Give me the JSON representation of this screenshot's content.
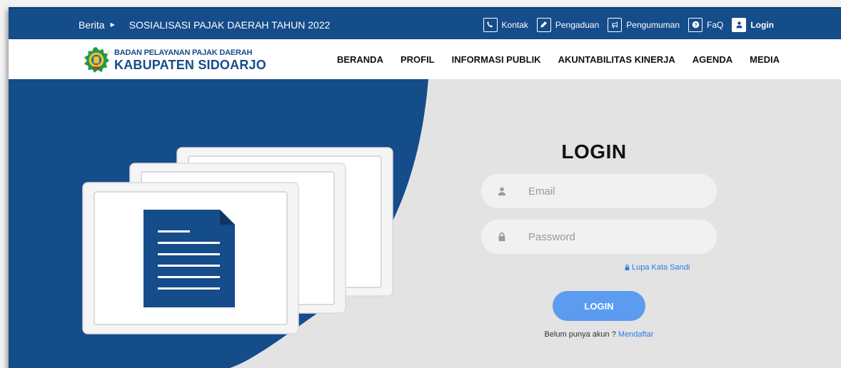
{
  "topbar": {
    "ticker_label": "Berita",
    "ticker_text": "SOSIALISASI PAJAK DAERAH TAHUN 2022",
    "links": {
      "kontak": "Kontak",
      "pengaduan": "Pengaduan",
      "pengumuman": "Pengumuman",
      "faq": "FaQ",
      "login": "Login"
    }
  },
  "brand": {
    "top": "BADAN PELAYANAN PAJAK DAERAH",
    "bottom": "KABUPATEN SIDOARJO"
  },
  "nav": {
    "beranda": "BERANDA",
    "profil": "PROFIL",
    "informasi_publik": "INFORMASI PUBLIK",
    "akuntabilitas_kinerja": "AKUNTABILITAS KINERJA",
    "agenda": "AGENDA",
    "media": "MEDIA"
  },
  "login": {
    "title": "LOGIN",
    "email_placeholder": "Email",
    "password_placeholder": "Password",
    "forgot": "Lupa Kata Sandi",
    "button": "LOGIN",
    "register_prompt": "Belum punya akun ?",
    "register_link": "Mendaftar"
  },
  "colors": {
    "primary": "#154c8a",
    "accent": "#5b9bf0",
    "link": "#2a7de1",
    "background": "#e3e3e3"
  },
  "icons": {
    "ticker": "caret-right-icon",
    "kontak": "phone-icon",
    "pengaduan": "pencil-icon",
    "pengumuman": "megaphone-icon",
    "faq": "question-icon",
    "login": "user-icon",
    "email": "user-icon",
    "password": "lock-icon",
    "forgot": "lock-icon"
  }
}
